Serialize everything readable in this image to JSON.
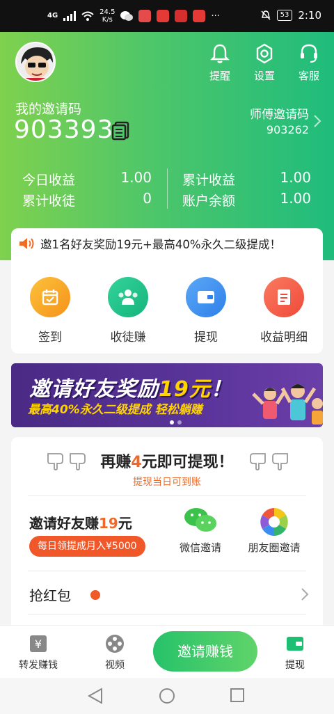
{
  "status_bar": {
    "network": "4G",
    "speed_value": "24.5",
    "speed_unit": "K/s",
    "battery": "53",
    "time": "2:10"
  },
  "header": {
    "actions": [
      {
        "icon": "bell-icon",
        "label": "提醒"
      },
      {
        "icon": "gear-icon",
        "label": "设置"
      },
      {
        "icon": "headset-icon",
        "label": "客服"
      }
    ],
    "invite_code_label": "我的邀请码",
    "invite_code": "903393",
    "master_label": "师傅邀请码",
    "master_code": "903262",
    "stats": [
      {
        "label": "今日收益",
        "value": "1.00"
      },
      {
        "label": "累计收徒",
        "value": "0"
      },
      {
        "label": "累计收益",
        "value": "1.00"
      },
      {
        "label": "账户余额",
        "value": "1.00"
      }
    ]
  },
  "notice": {
    "text": "邀1名好友奖励19元+最高40%永久二级提成！"
  },
  "menu": [
    {
      "label": "签到",
      "color": "#f7a51c",
      "icon": "calendar-icon"
    },
    {
      "label": "收徒赚",
      "color": "#22c08c",
      "icon": "people-icon"
    },
    {
      "label": "提现",
      "color": "#3c8ff0",
      "icon": "wallet-icon"
    },
    {
      "label": "收益明细",
      "color": "#f25a48",
      "icon": "document-icon"
    }
  ],
  "banner": {
    "title_pre": "邀请好友奖励",
    "title_amount": "19元",
    "title_end": "！",
    "subtitle": "最高40%永久二级提成  轻松躺赚"
  },
  "withdraw": {
    "head_pre": "再赚",
    "head_num": "4",
    "head_post": "元即可提现！",
    "sub": "提现当日可到账",
    "invite_title_pre": "邀请好友赚",
    "invite_title_num": "19",
    "invite_title_post": "元",
    "invite_badge": "每日领提成月入¥5000",
    "wechat_label": "微信邀请",
    "moments_label": "朋友圈邀请",
    "grab_label": "抢红包"
  },
  "tabbar": {
    "left1": "转发赚钱",
    "left2": "视频",
    "center": "邀请赚钱",
    "right": "提现"
  },
  "colors": {
    "brand_green": "#1fbc7c",
    "accent_orange": "#ef6a2a"
  }
}
